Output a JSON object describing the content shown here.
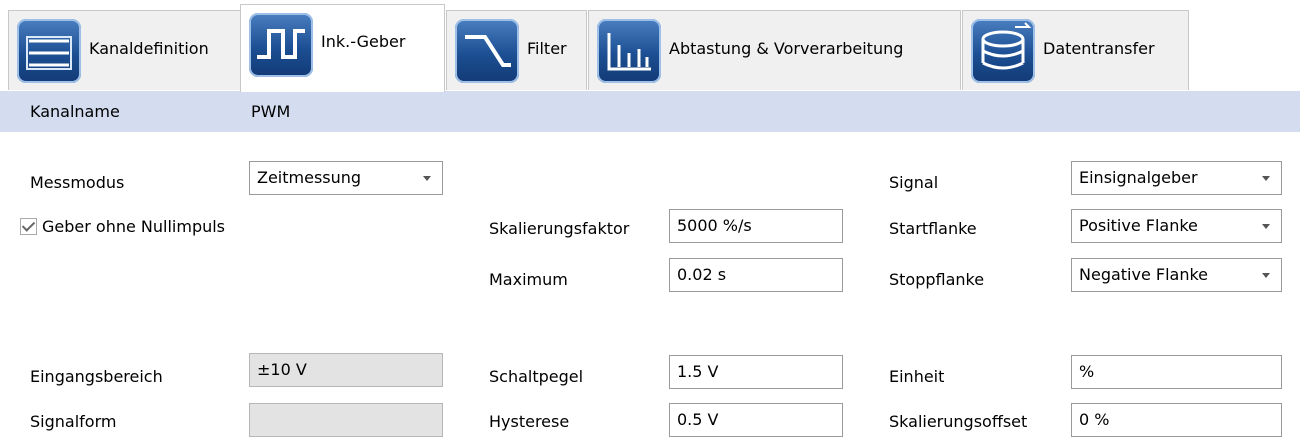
{
  "tabs": [
    {
      "label": "Kanaldefinition",
      "icon": "channel-definition-icon",
      "active": false
    },
    {
      "label": "Ink.-Geber",
      "icon": "pulse-encoder-icon",
      "active": true
    },
    {
      "label": "Filter",
      "icon": "filter-icon",
      "active": false
    },
    {
      "label": "Abtastung & Vorverarbeitung",
      "icon": "sampling-icon",
      "active": false
    },
    {
      "label": "Datentransfer",
      "icon": "data-transfer-icon",
      "active": false
    }
  ],
  "header": {
    "kanalname_label": "Kanalname",
    "kanalname_value": "PWM"
  },
  "left": {
    "messmodus_label": "Messmodus",
    "messmodus_value": "Zeitmessung",
    "nullimpuls_label": "Geber ohne Nullimpuls",
    "nullimpuls_checked": true,
    "eingangsbereich_label": "Eingangsbereich",
    "eingangsbereich_value": "±10 V",
    "signalform_label": "Signalform",
    "signalform_value": ""
  },
  "middle": {
    "skalierungsfaktor_label": "Skalierungsfaktor",
    "skalierungsfaktor_value": "5000 %/s",
    "maximum_label": "Maximum",
    "maximum_value": "0.02 s",
    "schaltpegel_label": "Schaltpegel",
    "schaltpegel_value": "1.5 V",
    "hysterese_label": "Hysterese",
    "hysterese_value": "0.5 V"
  },
  "right": {
    "signal_label": "Signal",
    "signal_value": "Einsignalgeber",
    "startflanke_label": "Startflanke",
    "startflanke_value": "Positive Flanke",
    "stoppflanke_label": "Stoppflanke",
    "stoppflanke_value": "Negative Flanke",
    "einheit_label": "Einheit",
    "einheit_value": "%",
    "skalierungsoffset_label": "Skalierungsoffset",
    "skalierungsoffset_value": "0 %"
  },
  "colors": {
    "header_band": "#d3ddef",
    "icon_blue": "#1c4f93",
    "readonly_bg": "#e3e3e3"
  }
}
